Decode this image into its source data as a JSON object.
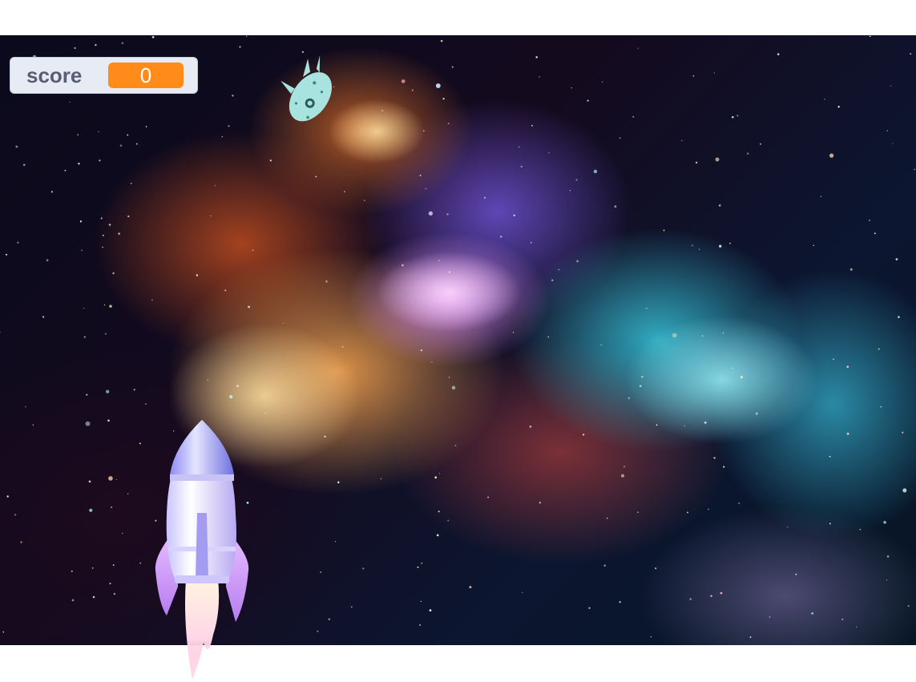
{
  "score_monitor": {
    "label": "score",
    "value": "0",
    "accent_color": "#ff8c1a",
    "background_color": "#e6ebf4",
    "label_color": "#575e75"
  },
  "stage": {
    "backdrop": "space-nebula-backdrop"
  },
  "sprites": {
    "rocket": "rocket-sprite",
    "alien_ship": "alien-ship-sprite"
  }
}
